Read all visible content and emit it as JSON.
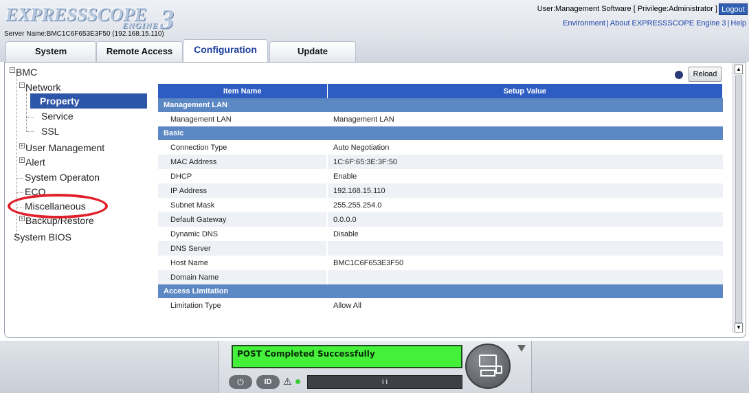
{
  "header": {
    "logo_main": "EXPRESSSCOPE",
    "logo_sub": "ENGINE",
    "logo_num": "3",
    "server_name": "Server Name:BMC1C6F653E3F50 (192.168.15.110)",
    "user_info": "User:Management Software [ Privilege:Administrator ]",
    "logout": "Logout",
    "links": [
      "Environment",
      "About EXPRESSSCOPE Engine 3",
      "Help"
    ]
  },
  "tabs": [
    "System",
    "Remote Access",
    "Configuration",
    "Update"
  ],
  "active_tab": "Configuration",
  "tree": {
    "bmc": "BMC",
    "network": "Network",
    "property": "Property",
    "service": "Service",
    "ssl": "SSL",
    "user_management": "User Management",
    "alert": "Alert",
    "system_operation": "System Operaton",
    "eco": "ECO",
    "miscellaneous": "Miscellaneous",
    "backup_restore": "Backup/Restore",
    "system_bios": "System BIOS"
  },
  "content": {
    "reload": "Reload",
    "col_item": "Item Name",
    "col_value": "Setup Value",
    "sections": [
      {
        "title": "Management LAN",
        "rows": [
          [
            "Management LAN",
            "Management LAN"
          ]
        ]
      },
      {
        "title": "Basic",
        "rows": [
          [
            "Connection Type",
            "Auto Negotiation"
          ],
          [
            "MAC Address",
            "1C:6F:65:3E:3F:50"
          ],
          [
            "DHCP",
            "Enable"
          ],
          [
            "IP Address",
            "192.168.15.110"
          ],
          [
            "Subnet Mask",
            "255.255.254.0"
          ],
          [
            "Default Gateway",
            "0.0.0.0"
          ],
          [
            "Dynamic DNS",
            "Disable"
          ],
          [
            "DNS Server",
            ""
          ],
          [
            "Host Name",
            "BMC1C6F653E3F50"
          ],
          [
            "Domain Name",
            ""
          ]
        ]
      },
      {
        "title": "Access Limitation",
        "rows": [
          [
            "Limitation Type",
            "Allow All"
          ]
        ]
      }
    ]
  },
  "status": {
    "lcd_message": "POST Completed Successfully",
    "power_label": "⏻",
    "id_label": "ID",
    "warning_icon": "⚠",
    "lcd_small": "i i"
  },
  "colors": {
    "header_blue": "#2d5cc2",
    "section_blue": "#5b87c3",
    "selected": "#2e56a8",
    "lcd_green": "#45f03a",
    "highlight_red": "#e0202a"
  }
}
